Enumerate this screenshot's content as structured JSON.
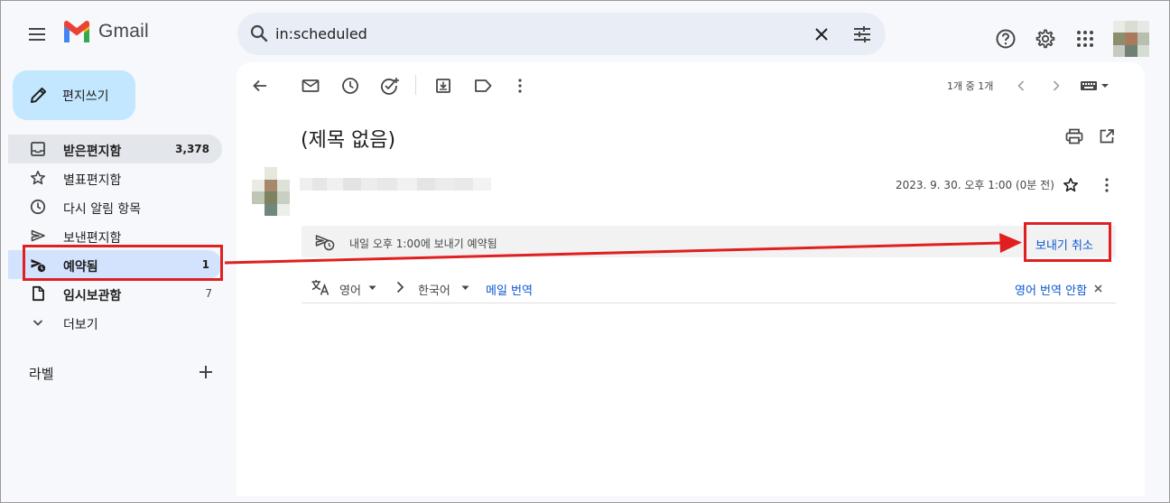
{
  "app": {
    "logo_text": "Gmail"
  },
  "search": {
    "query": "in:scheduled"
  },
  "compose": {
    "label": "편지쓰기"
  },
  "sidebar": {
    "items": [
      {
        "label": "받은편지함",
        "count": "3,378",
        "icon": "inbox-icon"
      },
      {
        "label": "별표편지함",
        "count": "",
        "icon": "star-icon"
      },
      {
        "label": "다시 알림 항목",
        "count": "",
        "icon": "clock-icon"
      },
      {
        "label": "보낸편지함",
        "count": "",
        "icon": "send-icon"
      },
      {
        "label": "예약됨",
        "count": "1",
        "icon": "scheduled-send-icon"
      },
      {
        "label": "임시보관함",
        "count": "7",
        "icon": "draft-icon"
      },
      {
        "label": "더보기",
        "count": "",
        "icon": "chevron-down-icon"
      }
    ],
    "labels_header": "라벨"
  },
  "toolbar": {
    "pager": "1개 중 1개"
  },
  "message": {
    "subject": "(제목 없음)",
    "date": "2023. 9. 30. 오후 1:00 (0분 전)",
    "scheduled_text": "내일 오후 1:00에 보내기 예약됨",
    "cancel_send": "보내기 취소"
  },
  "translate": {
    "source_lang": "영어",
    "target_lang": "한국어",
    "translate_link": "메일 번역",
    "never_translate": "영어 번역 안함"
  },
  "colors": {
    "accent_blue": "#0b57d0",
    "compose_bg": "#c2e7ff",
    "active_nav_bg": "#d3e3fd",
    "annotation_red": "#e02020"
  }
}
